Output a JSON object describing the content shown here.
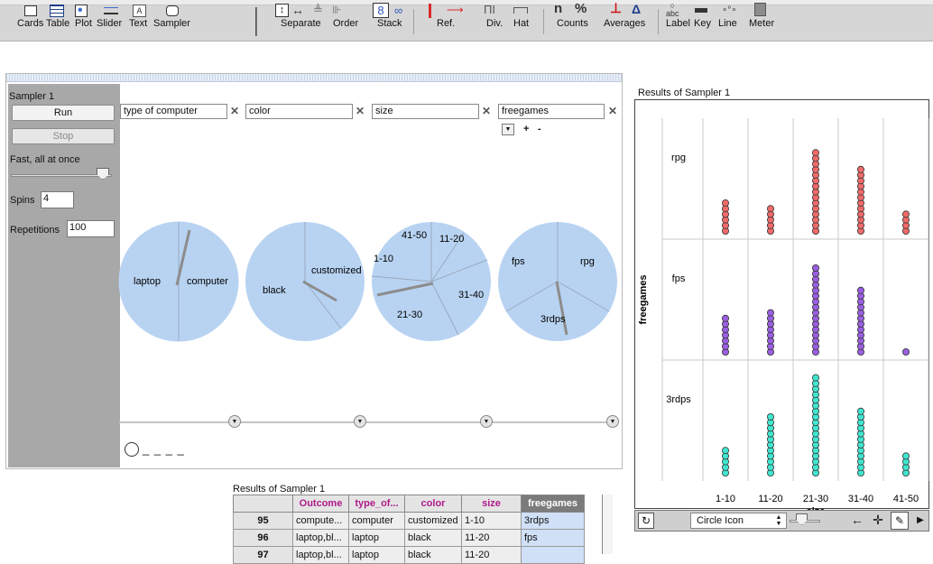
{
  "toolbar": {
    "items": [
      {
        "label": "Cards",
        "icon": "cards-icon"
      },
      {
        "label": "Table",
        "icon": "table-icon"
      },
      {
        "label": "Plot",
        "icon": "plot-icon"
      },
      {
        "label": "Slider",
        "icon": "slider-icon"
      },
      {
        "label": "Text",
        "icon": "text-icon"
      },
      {
        "label": "Sampler",
        "icon": "sampler-icon"
      },
      {
        "label": "Separate",
        "icon": "separate-icon"
      },
      {
        "label": "Order",
        "icon": "order-icon"
      },
      {
        "label": "Stack",
        "icon": "stack-icon"
      },
      {
        "label": "Ref.",
        "icon": "reference-icon"
      },
      {
        "label": "Div.",
        "icon": "divider-icon"
      },
      {
        "label": "Hat",
        "icon": "hat-icon"
      },
      {
        "label": "Counts",
        "icon": "counts-icon"
      },
      {
        "label": "Averages",
        "icon": "averages-icon"
      },
      {
        "label": "Label",
        "icon": "label-icon"
      },
      {
        "label": "Key",
        "icon": "key-icon"
      },
      {
        "label": "Line",
        "icon": "line-icon"
      },
      {
        "label": "Meter",
        "icon": "meter-icon"
      }
    ],
    "counts_glyph": "n",
    "percent_glyph": "%"
  },
  "sampler": {
    "title": "Sampler 1",
    "run_label": "Run",
    "stop_label": "Stop",
    "speed_label": "Fast, all at once",
    "speed_level": 1.0,
    "spins_label": "Spins",
    "spins_value": "4",
    "repetitions_label": "Repetitions",
    "repetitions_value": "100",
    "add_label": "+",
    "remove_label": "-",
    "outcome_placeholder": "_ _ _ _",
    "devices": [
      {
        "attribute": "type of computer",
        "labels": [
          "laptop",
          "computer"
        ]
      },
      {
        "attribute": "color",
        "labels": [
          "black",
          "customized"
        ]
      },
      {
        "attribute": "size",
        "labels": [
          "41-50",
          "11-20",
          "1-10",
          "31-40",
          "21-30"
        ]
      },
      {
        "attribute": "freegames",
        "labels": [
          "fps",
          "rpg",
          "3rdps"
        ]
      }
    ]
  },
  "results_plot": {
    "title": "Results of Sampler 1",
    "y_axis_label": "freegames",
    "x_axis_label": "size",
    "x_categories": [
      "1-10",
      "11-20",
      "21-30",
      "31-40",
      "41-50"
    ],
    "y_categories": [
      "rpg",
      "fps",
      "3rdps"
    ],
    "colors": {
      "rpg": "#f06a6a",
      "fps": "#9a5fe0",
      "3rdps": "#40e6d0"
    },
    "counts": {
      "rpg": [
        6,
        5,
        15,
        12,
        4
      ],
      "fps": [
        7,
        8,
        16,
        12,
        1
      ],
      "3rdps": [
        5,
        11,
        18,
        12,
        4
      ]
    },
    "icon_select_value": "Circle Icon"
  },
  "results_table": {
    "title": "Results of Sampler 1",
    "columns": [
      "",
      "Outcome",
      "type_of...",
      "color",
      "size",
      "freegames"
    ],
    "rows": [
      [
        "95",
        "compute...",
        "computer",
        "customized",
        "1-10",
        "3rdps"
      ],
      [
        "96",
        "laptop,bl...",
        "laptop",
        "black",
        "11-20",
        "fps"
      ],
      [
        "97",
        "laptop,bl...",
        "laptop",
        "black",
        "11-20",
        ""
      ]
    ]
  }
}
